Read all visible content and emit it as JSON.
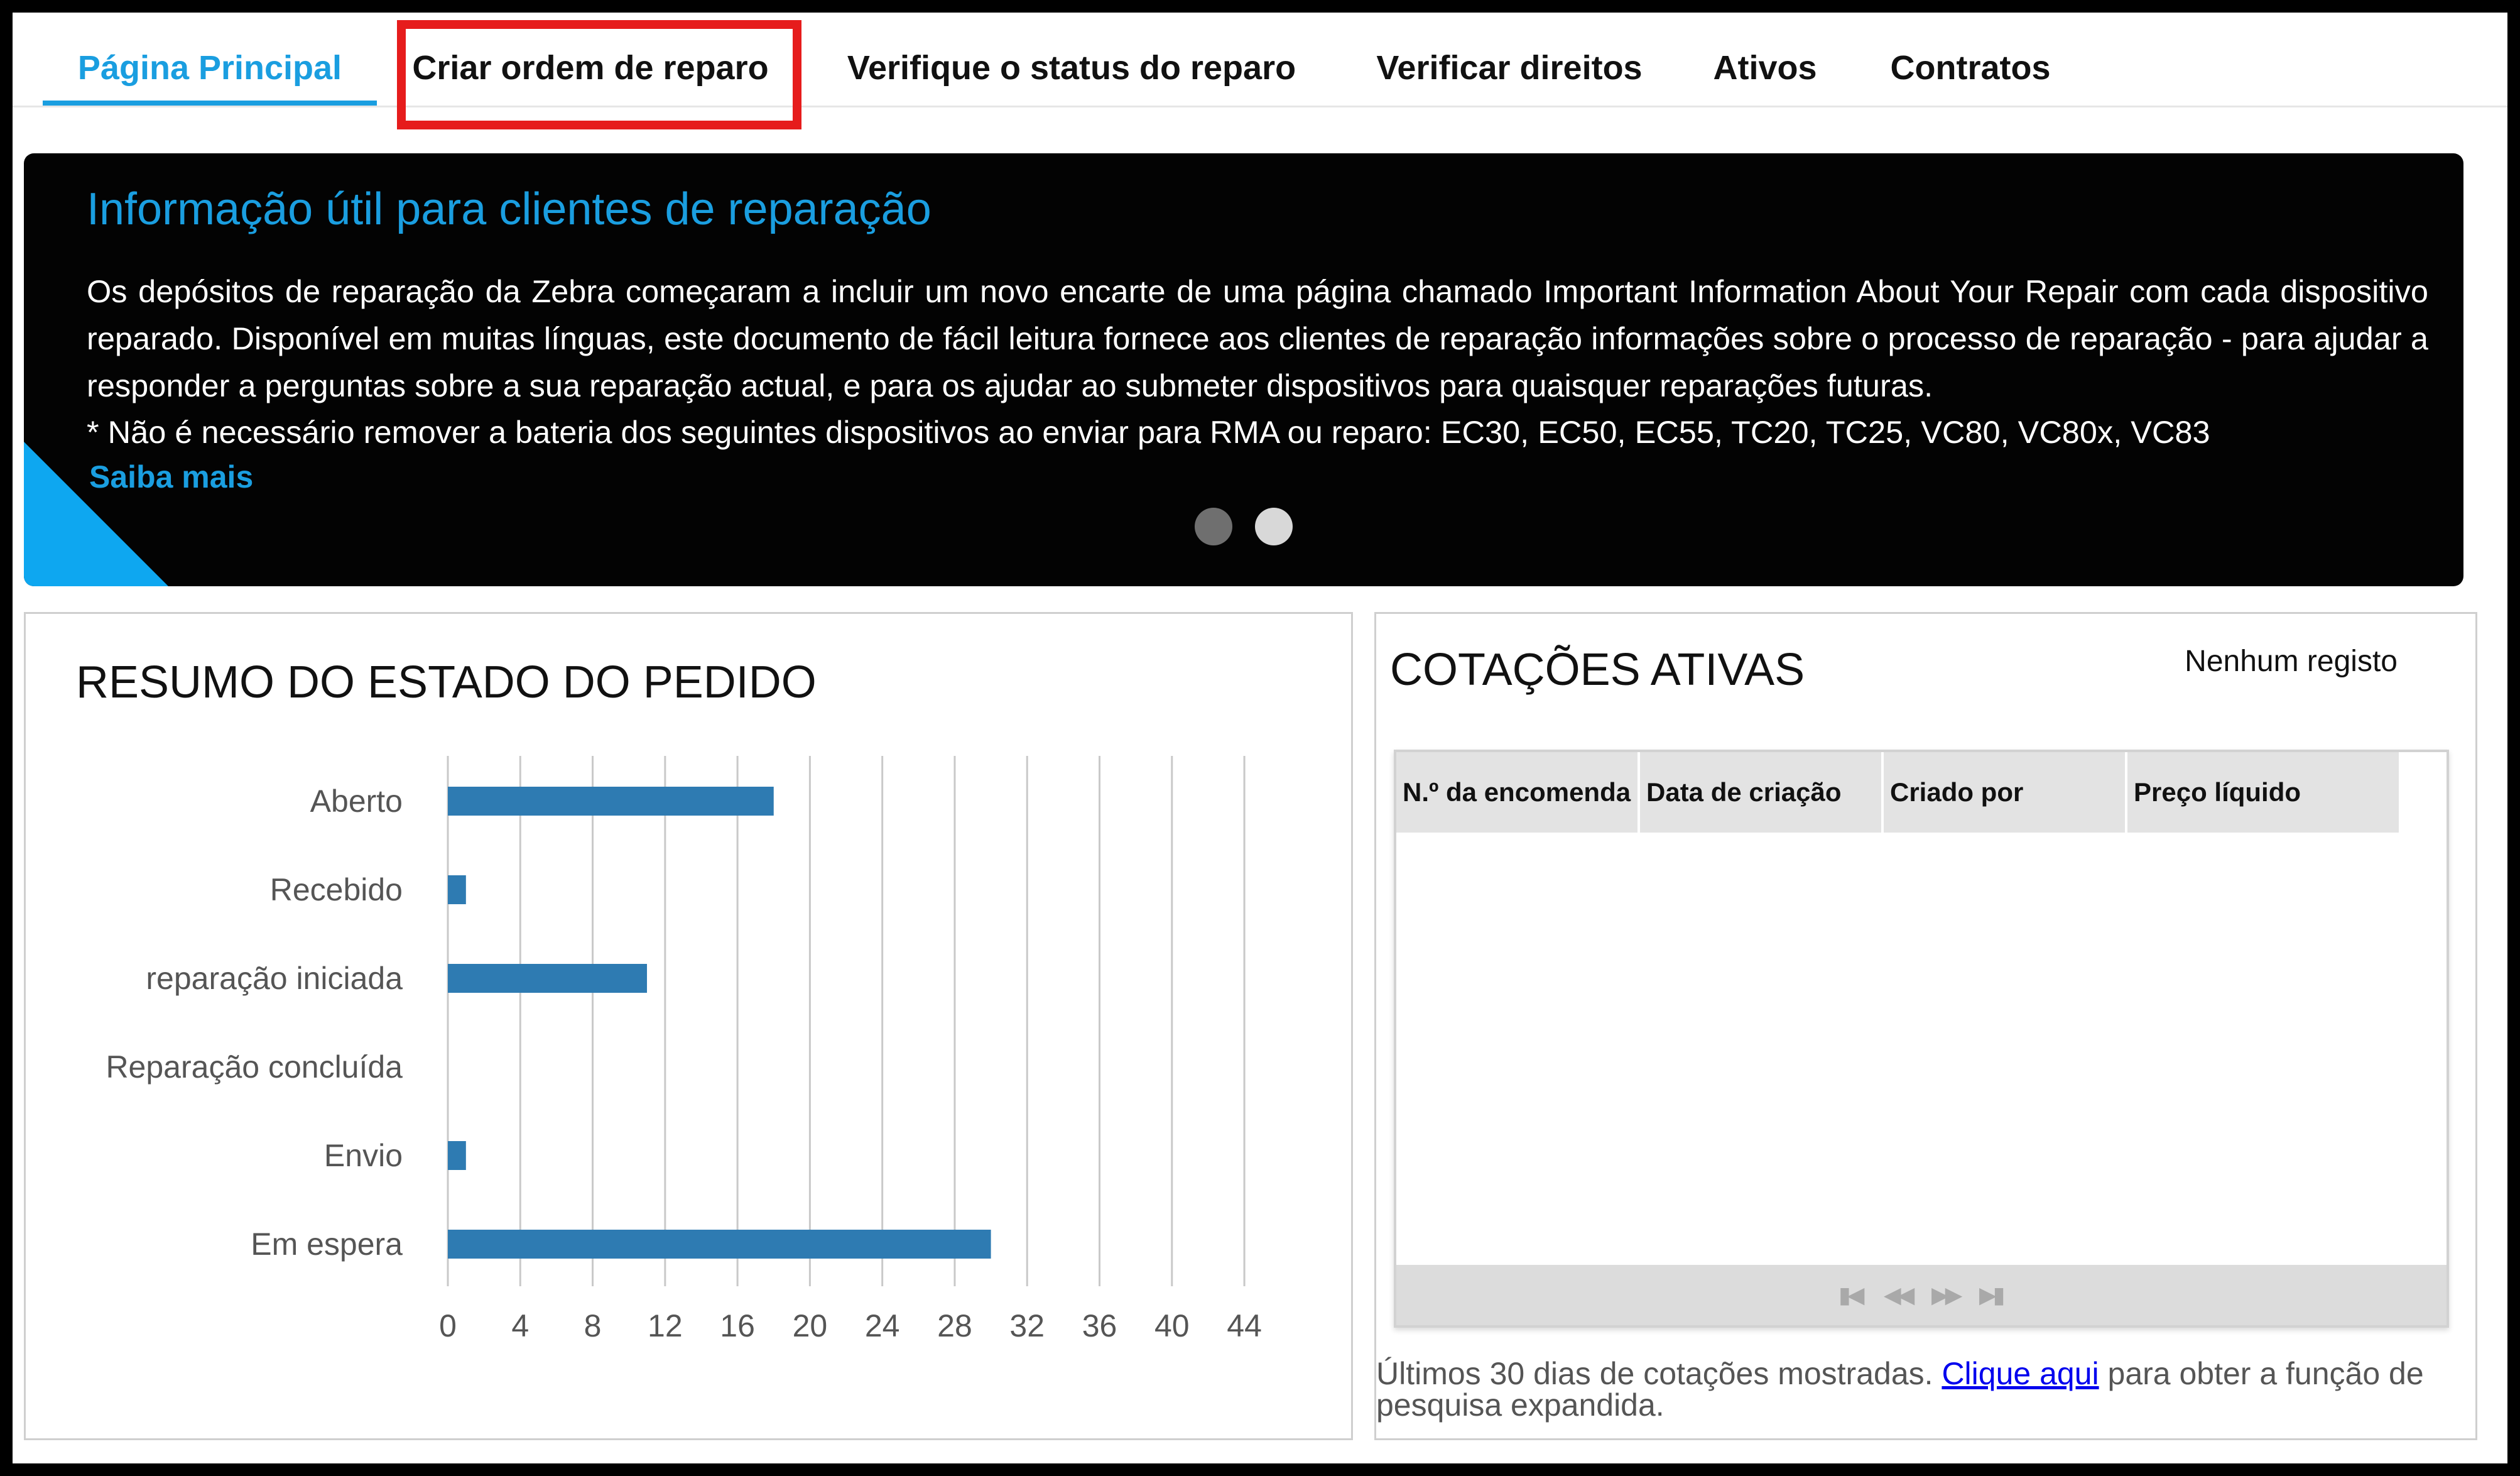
{
  "nav": {
    "tabs": [
      {
        "label": "Página Principal",
        "active": true
      },
      {
        "label": "Criar ordem de reparo",
        "highlighted": true
      },
      {
        "label": "Verifique o status do reparo"
      },
      {
        "label": "Verificar direitos"
      },
      {
        "label": "Ativos"
      },
      {
        "label": "Contratos"
      }
    ]
  },
  "banner": {
    "title": "Informação útil para clientes de reparação",
    "body": "Os depósitos de reparação da Zebra começaram a incluir um novo encarte de uma página chamado Important Information About Your Repair com cada dispositivo reparado. Disponível em muitas línguas, este documento de fácil leitura fornece aos clientes de reparação informações sobre o processo de reparação - para ajudar a responder a perguntas sobre a sua reparação actual, e para os ajudar ao submeter dispositivos para quaisquer reparações futuras.",
    "note": "* Não é necessário remover a bateria dos seguintes dispositivos ao enviar para RMA ou reparo: EC30, EC50, EC55, TC20, TC25, VC80, VC80x, VC83",
    "link_label": "Saiba mais",
    "slides": 2,
    "active_slide": 1
  },
  "summary": {
    "title": "RESUMO DO ESTADO DO PEDIDO"
  },
  "chart_data": {
    "type": "bar",
    "orientation": "horizontal",
    "title": "RESUMO DO ESTADO DO PEDIDO",
    "categories": [
      "Aberto",
      "Recebido",
      "reparação iniciada",
      "Reparação concluída",
      "Envio",
      "Em espera"
    ],
    "values": [
      18,
      1,
      11,
      0,
      1,
      30
    ],
    "xlim": [
      0,
      44
    ],
    "xticks": [
      0,
      4,
      8,
      12,
      16,
      20,
      24,
      28,
      32,
      36,
      40,
      44
    ],
    "grid": true,
    "color": "#2e7bb2"
  },
  "quotes": {
    "title": "COTAÇÕES ATIVAS",
    "no_records": "Nenhum registo",
    "columns": [
      "N.º da encomenda",
      "Data de criação",
      "Criado por",
      "Preço líquido"
    ],
    "rows": [],
    "footer_prefix": "Últimos 30 dias de cotações mostradas.",
    "footer_link": "Clique aqui",
    "footer_suffix": "para obter a função de pesquisa expandida."
  },
  "colors": {
    "accent": "#1a9ee0",
    "highlight_box": "#e61c1c",
    "banner_bg": "#030303",
    "bar": "#2e7bb2"
  }
}
